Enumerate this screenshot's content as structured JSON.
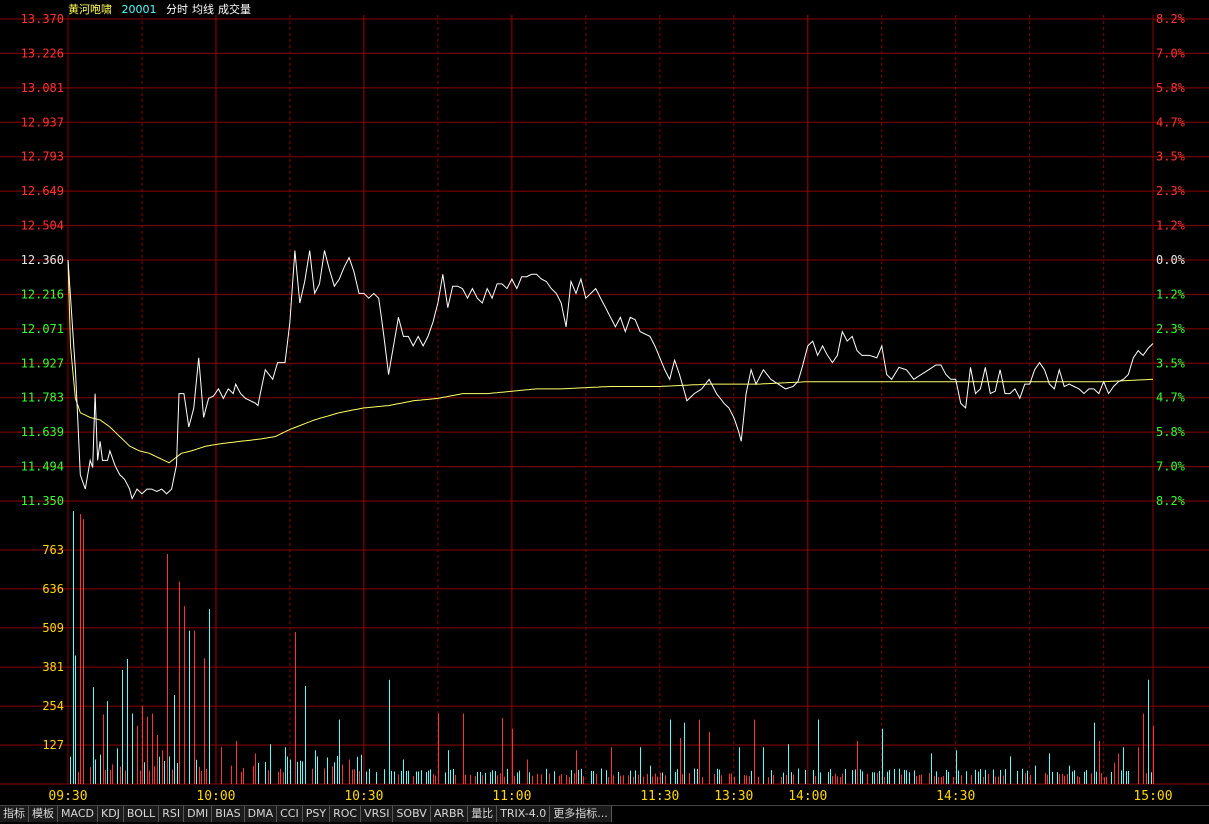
{
  "header": {
    "stock_name": "黄河咆啸",
    "stock_code": "20001",
    "modes": [
      "分时",
      "均线",
      "成交量"
    ]
  },
  "colors": {
    "up": "#ff3232",
    "down": "#32ff32",
    "flat": "#e6e6e6",
    "grid": "#8b0000",
    "price_line": "#ffffff",
    "avg_line": "#ffff66",
    "vol_up": "#ff3232",
    "vol_down": "#54ffff",
    "time_label": "#ffd700",
    "vol_label": "#ffd700",
    "name": "#ffff55",
    "code": "#54ffff"
  },
  "price_axis": {
    "left_labels": [
      "13.370",
      "13.226",
      "13.081",
      "12.937",
      "12.793",
      "12.649",
      "12.504",
      "12.360",
      "12.216",
      "12.071",
      "11.927",
      "11.783",
      "11.639",
      "11.494",
      "11.350"
    ],
    "right_labels": [
      "8.2%",
      "7.0%",
      "5.8%",
      "4.7%",
      "3.5%",
      "2.3%",
      "1.2%",
      "0.0%",
      "1.2%",
      "2.3%",
      "3.5%",
      "4.7%",
      "5.8%",
      "7.0%",
      "8.2%"
    ],
    "pre_close_index": 7
  },
  "volume_axis": {
    "labels": [
      "763",
      "636",
      "509",
      "381",
      "254",
      "127"
    ],
    "max": 890
  },
  "time_axis": {
    "labels": [
      "09:30",
      "10:00",
      "10:30",
      "11:00",
      "11:30",
      "13:30",
      "14:00",
      "14:30",
      "15:00"
    ]
  },
  "toolbar": {
    "buttons": [
      "指标",
      "模板",
      "MACD",
      "KDJ",
      "BOLL",
      "RSI",
      "DMI",
      "BIAS",
      "DMA",
      "CCI",
      "PSY",
      "ROC",
      "VRSI",
      "SOBV",
      "ARBR",
      "量比",
      "TRIX-4.0",
      "更多指标..."
    ]
  },
  "chart_data": {
    "type": "line",
    "pre_close": 12.36,
    "ylim": [
      11.35,
      13.37
    ],
    "price_keypoints": [
      [
        0,
        12.36
      ],
      [
        3,
        11.9
      ],
      [
        5,
        11.46
      ],
      [
        7,
        11.4
      ],
      [
        9,
        11.52
      ],
      [
        10,
        11.49
      ],
      [
        11,
        11.8
      ],
      [
        12,
        11.52
      ],
      [
        13,
        11.6
      ],
      [
        14,
        11.52
      ],
      [
        16,
        11.52
      ],
      [
        17,
        11.56
      ],
      [
        19,
        11.5
      ],
      [
        21,
        11.46
      ],
      [
        23,
        11.44
      ],
      [
        25,
        11.4
      ],
      [
        26,
        11.36
      ],
      [
        28,
        11.4
      ],
      [
        30,
        11.38
      ],
      [
        32,
        11.4
      ],
      [
        34,
        11.4
      ],
      [
        36,
        11.39
      ],
      [
        38,
        11.4
      ],
      [
        40,
        11.38
      ],
      [
        42,
        11.4
      ],
      [
        44,
        11.5
      ],
      [
        45,
        11.8
      ],
      [
        47,
        11.8
      ],
      [
        49,
        11.66
      ],
      [
        51,
        11.74
      ],
      [
        53,
        11.95
      ],
      [
        55,
        11.7
      ],
      [
        57,
        11.78
      ],
      [
        59,
        11.79
      ],
      [
        61,
        11.82
      ],
      [
        63,
        11.78
      ],
      [
        65,
        11.82
      ],
      [
        67,
        11.8
      ],
      [
        68,
        11.84
      ],
      [
        70,
        11.8
      ],
      [
        72,
        11.78
      ],
      [
        74,
        11.77
      ],
      [
        76,
        11.76
      ],
      [
        77,
        11.75
      ],
      [
        80,
        11.9
      ],
      [
        83,
        11.86
      ],
      [
        85,
        11.93
      ],
      [
        88,
        11.93
      ],
      [
        90,
        12.1
      ],
      [
        92,
        12.4
      ],
      [
        94,
        12.18
      ],
      [
        96,
        12.27
      ],
      [
        98,
        12.4
      ],
      [
        100,
        12.22
      ],
      [
        102,
        12.26
      ],
      [
        104,
        12.4
      ],
      [
        106,
        12.32
      ],
      [
        108,
        12.25
      ],
      [
        110,
        12.28
      ],
      [
        112,
        12.33
      ],
      [
        114,
        12.37
      ],
      [
        116,
        12.31
      ],
      [
        118,
        12.22
      ],
      [
        120,
        12.22
      ],
      [
        122,
        12.2
      ],
      [
        124,
        12.22
      ],
      [
        126,
        12.2
      ],
      [
        128,
        12.05
      ],
      [
        130,
        11.88
      ],
      [
        132,
        12.0
      ],
      [
        134,
        12.12
      ],
      [
        136,
        12.04
      ],
      [
        138,
        12.04
      ],
      [
        140,
        12.0
      ],
      [
        142,
        12.04
      ],
      [
        144,
        12.0
      ],
      [
        146,
        12.04
      ],
      [
        148,
        12.1
      ],
      [
        150,
        12.18
      ],
      [
        152,
        12.3
      ],
      [
        154,
        12.16
      ],
      [
        156,
        12.25
      ],
      [
        158,
        12.25
      ],
      [
        160,
        12.24
      ],
      [
        162,
        12.2
      ],
      [
        164,
        12.24
      ],
      [
        166,
        12.2
      ],
      [
        168,
        12.18
      ],
      [
        170,
        12.24
      ],
      [
        172,
        12.2
      ],
      [
        174,
        12.26
      ],
      [
        176,
        12.26
      ],
      [
        178,
        12.24
      ],
      [
        180,
        12.28
      ],
      [
        182,
        12.24
      ],
      [
        184,
        12.29
      ],
      [
        186,
        12.29
      ],
      [
        188,
        12.3
      ],
      [
        190,
        12.3
      ],
      [
        192,
        12.28
      ],
      [
        194,
        12.27
      ],
      [
        196,
        12.24
      ],
      [
        198,
        12.22
      ],
      [
        200,
        12.18
      ],
      [
        202,
        12.08
      ],
      [
        204,
        12.27
      ],
      [
        206,
        12.22
      ],
      [
        208,
        12.28
      ],
      [
        210,
        12.2
      ],
      [
        212,
        12.22
      ],
      [
        214,
        12.24
      ],
      [
        216,
        12.2
      ],
      [
        218,
        12.16
      ],
      [
        220,
        12.12
      ],
      [
        222,
        12.08
      ],
      [
        224,
        12.12
      ],
      [
        226,
        12.06
      ],
      [
        228,
        12.12
      ],
      [
        230,
        12.11
      ],
      [
        232,
        12.06
      ],
      [
        236,
        12.04
      ],
      [
        238,
        12.0
      ],
      [
        242,
        11.9
      ],
      [
        244,
        11.86
      ],
      [
        246,
        11.94
      ],
      [
        248,
        11.88
      ],
      [
        251,
        11.77
      ],
      [
        254,
        11.8
      ],
      [
        257,
        11.82
      ],
      [
        260,
        11.86
      ],
      [
        263,
        11.8
      ],
      [
        266,
        11.76
      ],
      [
        268,
        11.74
      ],
      [
        270,
        11.7
      ],
      [
        272,
        11.64
      ],
      [
        273,
        11.6
      ],
      [
        275,
        11.8
      ],
      [
        277,
        11.9
      ],
      [
        279,
        11.84
      ],
      [
        282,
        11.9
      ],
      [
        285,
        11.86
      ],
      [
        288,
        11.84
      ],
      [
        291,
        11.82
      ],
      [
        294,
        11.83
      ],
      [
        296,
        11.85
      ],
      [
        298,
        11.92
      ],
      [
        300,
        12.0
      ],
      [
        302,
        12.02
      ],
      [
        304,
        11.96
      ],
      [
        306,
        12.0
      ],
      [
        308,
        11.96
      ],
      [
        310,
        11.93
      ],
      [
        312,
        11.96
      ],
      [
        314,
        12.06
      ],
      [
        316,
        12.02
      ],
      [
        318,
        12.04
      ],
      [
        320,
        11.98
      ],
      [
        322,
        11.96
      ],
      [
        325,
        11.96
      ],
      [
        328,
        11.95
      ],
      [
        330,
        12.0
      ],
      [
        332,
        11.88
      ],
      [
        334,
        11.86
      ],
      [
        337,
        11.91
      ],
      [
        340,
        11.9
      ],
      [
        343,
        11.86
      ],
      [
        346,
        11.88
      ],
      [
        349,
        11.9
      ],
      [
        352,
        11.92
      ],
      [
        354,
        11.92
      ],
      [
        356,
        11.88
      ],
      [
        358,
        11.86
      ],
      [
        360,
        11.86
      ],
      [
        362,
        11.76
      ],
      [
        364,
        11.74
      ],
      [
        366,
        11.91
      ],
      [
        368,
        11.8
      ],
      [
        370,
        11.82
      ],
      [
        372,
        11.91
      ],
      [
        374,
        11.8
      ],
      [
        376,
        11.81
      ],
      [
        378,
        11.9
      ],
      [
        380,
        11.8
      ],
      [
        382,
        11.8
      ],
      [
        384,
        11.82
      ],
      [
        386,
        11.78
      ],
      [
        388,
        11.84
      ],
      [
        390,
        11.84
      ],
      [
        392,
        11.9
      ],
      [
        394,
        11.93
      ],
      [
        396,
        11.9
      ],
      [
        398,
        11.84
      ],
      [
        400,
        11.82
      ],
      [
        402,
        11.9
      ],
      [
        404,
        11.83
      ],
      [
        406,
        11.84
      ],
      [
        410,
        11.82
      ],
      [
        412,
        11.8
      ],
      [
        414,
        11.82
      ],
      [
        416,
        11.82
      ],
      [
        418,
        11.8
      ],
      [
        420,
        11.85
      ],
      [
        422,
        11.8
      ],
      [
        424,
        11.83
      ],
      [
        426,
        11.85
      ],
      [
        428,
        11.86
      ],
      [
        430,
        11.88
      ],
      [
        432,
        11.95
      ],
      [
        434,
        11.98
      ],
      [
        436,
        11.96
      ],
      [
        438,
        11.99
      ],
      [
        440,
        12.01
      ]
    ],
    "avg_keypoints": [
      [
        0,
        12.36
      ],
      [
        1,
        12.0
      ],
      [
        3,
        11.78
      ],
      [
        5,
        11.72
      ],
      [
        9,
        11.7
      ],
      [
        13,
        11.69
      ],
      [
        17,
        11.66
      ],
      [
        21,
        11.62
      ],
      [
        25,
        11.58
      ],
      [
        29,
        11.56
      ],
      [
        33,
        11.55
      ],
      [
        37,
        11.53
      ],
      [
        41,
        11.51
      ],
      [
        46,
        11.55
      ],
      [
        50,
        11.56
      ],
      [
        56,
        11.58
      ],
      [
        62,
        11.59
      ],
      [
        70,
        11.6
      ],
      [
        78,
        11.61
      ],
      [
        84,
        11.62
      ],
      [
        90,
        11.65
      ],
      [
        95,
        11.67
      ],
      [
        100,
        11.69
      ],
      [
        110,
        11.72
      ],
      [
        120,
        11.74
      ],
      [
        130,
        11.75
      ],
      [
        140,
        11.77
      ],
      [
        150,
        11.78
      ],
      [
        160,
        11.8
      ],
      [
        170,
        11.8
      ],
      [
        180,
        11.81
      ],
      [
        190,
        11.82
      ],
      [
        200,
        11.82
      ],
      [
        220,
        11.83
      ],
      [
        240,
        11.83
      ],
      [
        260,
        11.84
      ],
      [
        280,
        11.84
      ],
      [
        300,
        11.85
      ],
      [
        320,
        11.85
      ],
      [
        340,
        11.85
      ],
      [
        360,
        11.85
      ],
      [
        380,
        11.85
      ],
      [
        400,
        11.85
      ],
      [
        420,
        11.85
      ],
      [
        440,
        11.86
      ]
    ],
    "volume_keypoints": [
      [
        2,
        890,
        "d"
      ],
      [
        3,
        419,
        "d"
      ],
      [
        5,
        880,
        "u"
      ],
      [
        6,
        863,
        "u"
      ],
      [
        10,
        316,
        "d"
      ],
      [
        14,
        227,
        "u"
      ],
      [
        16,
        270,
        "d"
      ],
      [
        20,
        116,
        "d"
      ],
      [
        22,
        372,
        "d"
      ],
      [
        24,
        408,
        "d"
      ],
      [
        26,
        230,
        "d"
      ],
      [
        28,
        190,
        "u"
      ],
      [
        30,
        254,
        "u"
      ],
      [
        32,
        220,
        "u"
      ],
      [
        34,
        230,
        "u"
      ],
      [
        36,
        160,
        "u"
      ],
      [
        38,
        110,
        "u"
      ],
      [
        40,
        750,
        "u"
      ],
      [
        43,
        290,
        "d"
      ],
      [
        45,
        660,
        "u"
      ],
      [
        47,
        580,
        "u"
      ],
      [
        49,
        500,
        "d"
      ],
      [
        51,
        500,
        "u"
      ],
      [
        55,
        410,
        "u"
      ],
      [
        57,
        570,
        "d"
      ],
      [
        62,
        120,
        "u"
      ],
      [
        68,
        140,
        "u"
      ],
      [
        76,
        100,
        "u"
      ],
      [
        82,
        130,
        "d"
      ],
      [
        88,
        120,
        "d"
      ],
      [
        92,
        495,
        "u"
      ],
      [
        96,
        320,
        "d"
      ],
      [
        100,
        110,
        "d"
      ],
      [
        110,
        210,
        "d"
      ],
      [
        114,
        80,
        "u"
      ],
      [
        130,
        340,
        "d"
      ],
      [
        136,
        80,
        "d"
      ],
      [
        150,
        230,
        "u"
      ],
      [
        154,
        110,
        "d"
      ],
      [
        160,
        230,
        "u"
      ],
      [
        176,
        215,
        "u"
      ],
      [
        180,
        180,
        "u"
      ],
      [
        186,
        80,
        "u"
      ],
      [
        206,
        110,
        "u"
      ],
      [
        220,
        120,
        "u"
      ],
      [
        232,
        120,
        "d"
      ],
      [
        236,
        60,
        "d"
      ],
      [
        244,
        210,
        "d"
      ],
      [
        248,
        150,
        "u"
      ],
      [
        250,
        200,
        "d"
      ],
      [
        256,
        210,
        "u"
      ],
      [
        260,
        170,
        "u"
      ],
      [
        272,
        120,
        "d"
      ],
      [
        278,
        210,
        "u"
      ],
      [
        282,
        120,
        "d"
      ],
      [
        292,
        130,
        "d"
      ],
      [
        304,
        210,
        "d"
      ],
      [
        320,
        140,
        "u"
      ],
      [
        330,
        180,
        "d"
      ],
      [
        350,
        100,
        "d"
      ],
      [
        360,
        110,
        "d"
      ],
      [
        382,
        90,
        "d"
      ],
      [
        392,
        60,
        "d"
      ],
      [
        398,
        100,
        "d"
      ],
      [
        406,
        60,
        "d"
      ],
      [
        416,
        200,
        "d"
      ],
      [
        418,
        140,
        "u"
      ],
      [
        424,
        70,
        "u"
      ],
      [
        426,
        100,
        "u"
      ],
      [
        428,
        120,
        "d"
      ],
      [
        434,
        120,
        "u"
      ],
      [
        436,
        230,
        "u"
      ],
      [
        438,
        340,
        "d"
      ],
      [
        440,
        190,
        "u"
      ]
    ]
  }
}
